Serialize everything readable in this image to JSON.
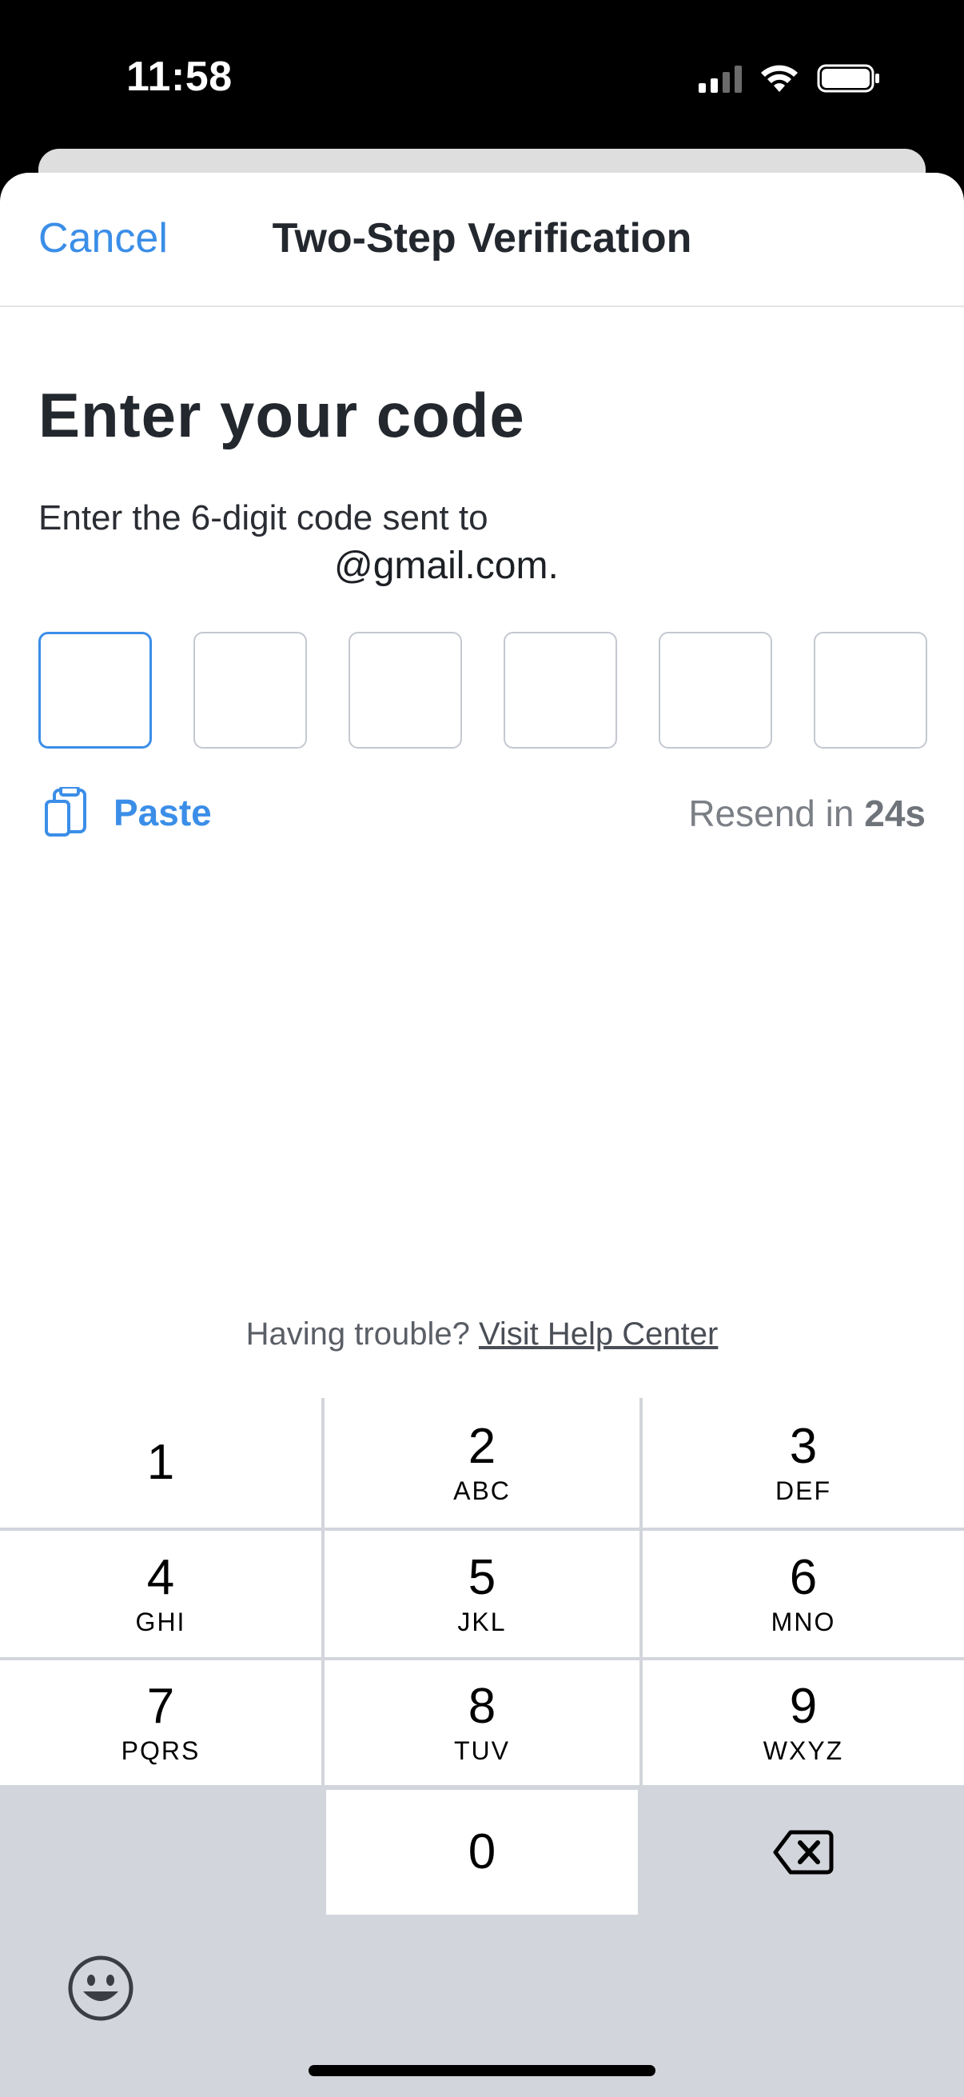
{
  "status_bar": {
    "time": "11:58"
  },
  "nav": {
    "cancel": "Cancel",
    "title": "Two-Step Verification"
  },
  "content": {
    "heading": "Enter your code",
    "instructions": "Enter the 6-digit code sent to",
    "email": "@gmail.com.",
    "paste_label": "Paste",
    "resend_prefix": "Resend in",
    "resend_seconds": "24s",
    "trouble_prefix": "Having trouble?",
    "help_link": "Visit Help Center"
  },
  "keypad": {
    "keys": [
      {
        "num": "1",
        "letters": ""
      },
      {
        "num": "2",
        "letters": "ABC"
      },
      {
        "num": "3",
        "letters": "DEF"
      },
      {
        "num": "4",
        "letters": "GHI"
      },
      {
        "num": "5",
        "letters": "JKL"
      },
      {
        "num": "6",
        "letters": "MNO"
      },
      {
        "num": "7",
        "letters": "PQRS"
      },
      {
        "num": "8",
        "letters": "TUV"
      },
      {
        "num": "9",
        "letters": "WXYZ"
      },
      {
        "num": "0",
        "letters": ""
      }
    ]
  },
  "colors": {
    "accent": "#3b8ee8",
    "keypad_bg": "#d2d5db"
  }
}
